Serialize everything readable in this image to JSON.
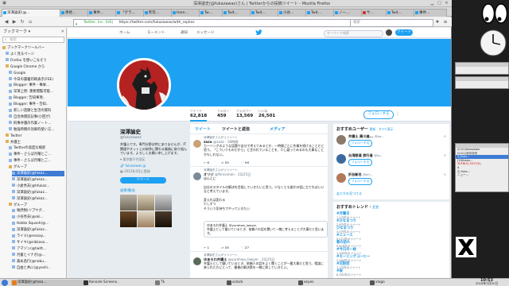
{
  "window": {
    "title": "深澤諭史(@fukazawas)さん | Twitterからの投稿ツイート - Mozilla Firefox"
  },
  "tabs": [
    {
      "label": "深澤論史(@...",
      "icon": "twitter",
      "active": true
    },
    {
      "label": "専修…",
      "icon": "twitter"
    },
    {
      "label": "事件…",
      "icon": "twitter"
    },
    {
      "label": "「グラ…",
      "icon": "twitter"
    },
    {
      "label": "昨年…",
      "icon": "twitter"
    },
    {
      "label": "Hom…",
      "icon": "twitter"
    },
    {
      "label": "Tw…",
      "icon": "twitter"
    },
    {
      "label": "Twit…",
      "icon": "twitter"
    },
    {
      "label": "Twit…",
      "icon": "twitter"
    },
    {
      "label": "小谷…",
      "icon": "twitter"
    },
    {
      "label": "Twit…",
      "icon": "twitter"
    },
    {
      "label": "ノー…",
      "icon": "twitter"
    },
    {
      "label": "サ…",
      "icon": "red"
    },
    {
      "label": "Twit…",
      "icon": "twitter"
    },
    {
      "label": "事件…",
      "icon": "twitter"
    }
  ],
  "nav": {
    "url_secure": "Twitter, Inc. (US)",
    "url": "https://twitter.com/fukazawas/with_replies",
    "search_placeholder": "検索"
  },
  "sidebar": {
    "title": "ブックマーク",
    "search_placeholder": "検索",
    "items": [
      {
        "label": "ブックマークツールバー",
        "indent": 0,
        "type": "folder"
      },
      {
        "label": "よく見るページ",
        "indent": 1,
        "type": "page"
      },
      {
        "label": "Firefox を使いこなそう",
        "indent": 1,
        "type": "page"
      },
      {
        "label": "Google Chrome から",
        "indent": 1,
        "type": "folder"
      },
      {
        "label": "Google",
        "indent": 2,
        "type": "page"
      },
      {
        "label": "今日の書籍印刷表示(FEE)",
        "indent": 2,
        "type": "page"
      },
      {
        "label": "Blogger: 事件・事故...",
        "indent": 2,
        "type": "page"
      },
      {
        "label": "深澤上原: 重要閲覧可能...",
        "indent": 2,
        "type": "page"
      },
      {
        "label": "Blogger: 告知事項..",
        "indent": 2,
        "type": "page"
      },
      {
        "label": "Blogger: 事件・告知..",
        "indent": 2,
        "type": "page"
      },
      {
        "label": "新しい話題と生活の資料",
        "indent": 2,
        "type": "page"
      },
      {
        "label": "自治体雑誌記事(小回ぜ)",
        "indent": 2,
        "type": "page"
      },
      {
        "label": "刑事弁護の作業ノート...",
        "indent": 2,
        "type": "page"
      },
      {
        "label": "勉強時間の効果的使い方...",
        "indent": 2,
        "type": "page"
      },
      {
        "label": "Twitter",
        "indent": 1,
        "type": "folder"
      },
      {
        "label": "弁護士",
        "indent": 1,
        "type": "folder"
      },
      {
        "label": "Twitterの高度な検索",
        "indent": 2,
        "type": "page"
      },
      {
        "label": "事件・さらば月曜とご...",
        "indent": 2,
        "type": "page"
      },
      {
        "label": "事件・さらば月曜とご...",
        "indent": 2,
        "type": "page"
      },
      {
        "label": "グループ",
        "indent": 2,
        "type": "folder"
      },
      {
        "label": "深澤論史(@fukaz...",
        "indent": 3,
        "type": "page",
        "selected": true
      },
      {
        "label": "深澤論史(@fukaz...",
        "indent": 3,
        "type": "page"
      },
      {
        "label": "小倉秀夫(@hfukaz...",
        "indent": 3,
        "type": "page"
      },
      {
        "label": "深澤論史(@fukaz...",
        "indent": 3,
        "type": "page"
      },
      {
        "label": "深澤論史(@fukaz...",
        "indent": 3,
        "type": "page"
      },
      {
        "label": "グループ",
        "indent": 2,
        "type": "folder"
      },
      {
        "label": "唯然物(ツブヤグ...",
        "indent": 3,
        "type": "page"
      },
      {
        "label": "小谷秀夫(@oki...",
        "indent": 3,
        "type": "page"
      },
      {
        "label": "Hokke Squash(@...",
        "indent": 3,
        "type": "page"
      },
      {
        "label": "深澤論史(@fukaz...",
        "indent": 3,
        "type": "page"
      },
      {
        "label": "ライミ(@reasay...",
        "indent": 3,
        "type": "page"
      },
      {
        "label": "サイキ(@nikkasa...",
        "indent": 3,
        "type": "page"
      },
      {
        "label": "アマゾン(@twitt...",
        "indent": 3,
        "type": "page"
      },
      {
        "label": "河童とイナガ(@...",
        "indent": 3,
        "type": "page"
      },
      {
        "label": "森永昌行(@nobu...",
        "indent": 3,
        "type": "page"
      },
      {
        "label": "自由と共に(@yoshi...",
        "indent": 3,
        "type": "page"
      }
    ]
  },
  "twitter": {
    "nav": {
      "home": "ホーム",
      "moments": "モーメント",
      "notifications": "通知",
      "messages": "メッセージ"
    },
    "search_placeholder": "キーワード検索",
    "tweet_button": "ツイート",
    "stats": [
      {
        "label": "ツイート",
        "value": "62,818"
      },
      {
        "label": "フォロー",
        "value": "459"
      },
      {
        "label": "フォロワー",
        "value": "13,569"
      },
      {
        "label": "いいね",
        "value": "26,501"
      }
    ],
    "follow_label": "フォローする",
    "profile": {
      "name": "深澤諭史",
      "handle": "@fukazawas",
      "bio": "弁護士です。専門分野は特にありませんが、IT関連やネット上の紛争に関わる業務に取り組んでいます。よろしくお願い申し上げます。",
      "location": "東京都千代田区",
      "url": "fukazawas.jp",
      "joined": "2012年3月に登録",
      "tweet_to": "ツイート",
      "media_link": "画像/動画"
    },
    "timeline_tabs": {
      "tweets": "ツイート",
      "replies": "ツイートと返信",
      "media": "メディア"
    },
    "tweets": [
      {
        "context": "深澤論史さんがリツイート",
        "name": "zaza",
        "handle": "@zaza · 18時間",
        "body": "カーリングのような話題で自分で考えてみるとか、一時間ごとに作業を続けることだと思う。「こういうものだから」と言われていることを、少し疑ってみるのも大事なことかもしれない。",
        "actions": [
          "6",
          "53",
          "96"
        ]
      },
      {
        "context": "深澤論史さんがリツイート",
        "name": "オリジ",
        "handle": "@fkncomon · 2月25日",
        "body": "ほんとに\n\n自分のスタイルの解決を目指していきたいと思う。少なくとも誰かの役に立てればいいなと考えています。\n\n変えれば変わる\n少しずつ\nそういう気持ちでやっていきたい",
        "quote": "ゆあろわ弁護士 @yurohwa_lawyer\n弁護士として働いているとき、依頼人の話を聞いて一緒に考えることが大事だと思います。",
        "actions": [
          "1",
          "35",
          "27"
        ]
      },
      {
        "context": "深澤論史さんがリツイート",
        "name": "ゆあろわ弁護士",
        "handle": "@yurohwa_lawyer · 2月25日",
        "body": "弁護士として働いているとき、依頼人の話をよく聞くことが一番大事だと思う。相談に来られた方にとって、最善の解決策を一緒に探していきたい。",
        "actions": [
          "",
          "",
          ""
        ]
      }
    ],
    "suggest_title": "おすすめユーザー",
    "suggest_links": "更新 · すべて表示",
    "suggestions": [
      {
        "name": "弁護士 黒川進...",
        "handle": "@ka...",
        "button": "フォローする"
      },
      {
        "name": "台湾鉄道 旅行者",
        "handle": "@ta...",
        "button": "フォローする"
      },
      {
        "name": "折谷新名",
        "handle": "@ori...",
        "button": "フォローする"
      }
    ],
    "suggest_footer": "友だちを見つける",
    "trends_title": "おすすめトレンド",
    "trends_link": "変更",
    "trends": [
      {
        "name": "#月曜日",
        "count": "1.2万件のツイート"
      },
      {
        "name": "#ひなまつり",
        "count": "2.8万件のツイート"
      },
      {
        "name": "ひなまつり",
        "count": "3.4万件のツイート"
      },
      {
        "name": "#ニュース",
        "count": "5,421件のツイート"
      },
      {
        "name": "春の訪れ",
        "count": "9,876件のツイート"
      },
      {
        "name": "#今日の一枚",
        "count": "1,345件のツイート"
      },
      {
        "name": "#モーニングコーヒー",
        "count": "2,044件のツイート"
      },
      {
        "name": "#花粉症",
        "count": "1.1万件のツイート"
      },
      {
        "name": "#桜",
        "count": "8,302件のツイート"
      }
    ]
  },
  "clipboard": [
    {
      "text": "(0:21)fukazawa",
      "style": "normal"
    },
    {
      "text": "(0:21)@@@@",
      "style": "normal"
    },
    {
      "text": "3_Kcal...",
      "style": "hl"
    },
    {
      "text": "(10)kaan...",
      "style": "normal"
    },
    {
      "text": "2016(5) 2017(5)",
      "style": "red"
    },
    {
      "text": "4",
      "style": "normal"
    },
    {
      "text": "2) fuka...",
      "style": "normal"
    },
    {
      "text": "ニュー...",
      "style": "normal"
    }
  ],
  "taskbar": [
    {
      "label": "深澤論史(@fuka...",
      "active": true,
      "icon": "#e87a1d"
    },
    {
      "label": "Konsole Screens..",
      "active": false,
      "icon": "#333"
    },
    {
      "label": "Tk",
      "active": false,
      "icon": "#7a7a7a"
    },
    {
      "label": "xclock",
      "active": false,
      "icon": "#555"
    },
    {
      "label": "xeyes",
      "active": false,
      "icon": "#555"
    },
    {
      "label": "xlogo",
      "active": false,
      "icon": "#555"
    }
  ],
  "clock": {
    "time": "10:53",
    "date": "2018年3月02日"
  }
}
